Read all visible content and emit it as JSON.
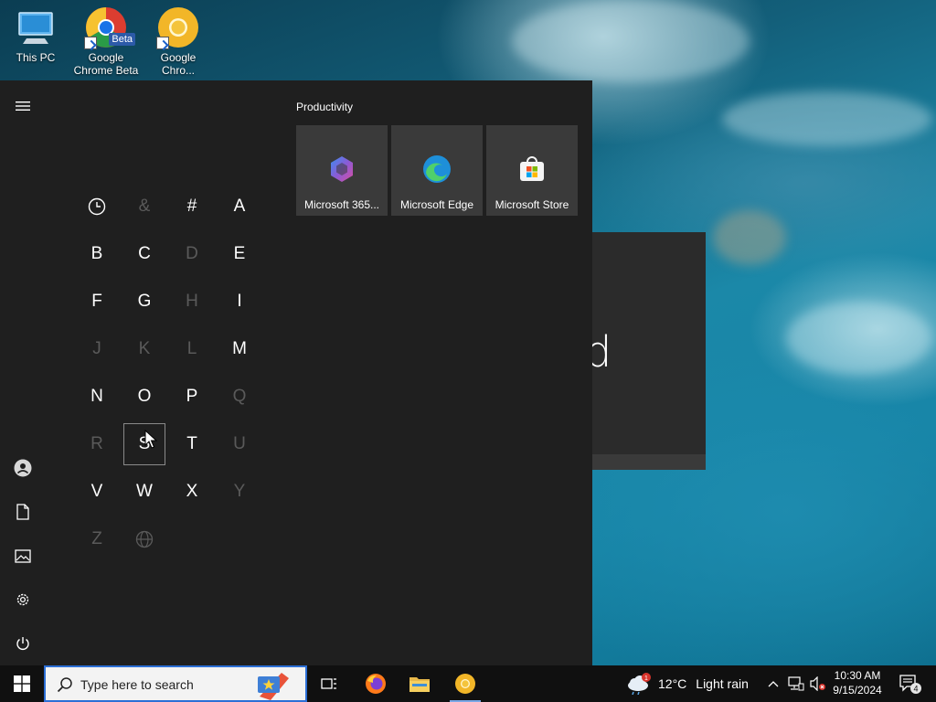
{
  "desktop": {
    "icons": [
      {
        "label": "This PC"
      },
      {
        "label": "Google Chrome Beta",
        "badge": "Beta"
      },
      {
        "label": "Google Chro..."
      }
    ]
  },
  "start_menu": {
    "letters": [
      {
        "char": "clock-icon",
        "enabled": true
      },
      {
        "char": "&",
        "enabled": false
      },
      {
        "char": "#",
        "enabled": true
      },
      {
        "char": "A",
        "enabled": true
      },
      {
        "char": "B",
        "enabled": true
      },
      {
        "char": "C",
        "enabled": true
      },
      {
        "char": "D",
        "enabled": false
      },
      {
        "char": "E",
        "enabled": true
      },
      {
        "char": "F",
        "enabled": true
      },
      {
        "char": "G",
        "enabled": true
      },
      {
        "char": "H",
        "enabled": false
      },
      {
        "char": "I",
        "enabled": true
      },
      {
        "char": "J",
        "enabled": false
      },
      {
        "char": "K",
        "enabled": false
      },
      {
        "char": "L",
        "enabled": false
      },
      {
        "char": "M",
        "enabled": true
      },
      {
        "char": "N",
        "enabled": true
      },
      {
        "char": "O",
        "enabled": true
      },
      {
        "char": "P",
        "enabled": true
      },
      {
        "char": "Q",
        "enabled": false
      },
      {
        "char": "R",
        "enabled": false
      },
      {
        "char": "S",
        "enabled": true
      },
      {
        "char": "T",
        "enabled": true
      },
      {
        "char": "U",
        "enabled": false
      },
      {
        "char": "V",
        "enabled": true
      },
      {
        "char": "W",
        "enabled": true
      },
      {
        "char": "X",
        "enabled": true
      },
      {
        "char": "Y",
        "enabled": false
      },
      {
        "char": "Z",
        "enabled": false
      },
      {
        "char": "globe-icon",
        "enabled": false
      }
    ],
    "tile_group": {
      "title": "Productivity",
      "tiles": [
        {
          "label": "Microsoft 365...",
          "icon": "microsoft-365-icon"
        },
        {
          "label": "Microsoft Edge",
          "icon": "edge-icon"
        },
        {
          "label": "Microsoft Store",
          "icon": "store-icon"
        }
      ]
    },
    "rail": [
      "hamburger-icon",
      "user-icon",
      "document-icon",
      "pictures-icon",
      "settings-icon",
      "power-icon"
    ]
  },
  "background_window": {
    "glyph": "d"
  },
  "taskbar": {
    "search_placeholder": "Type here to search",
    "weather": {
      "temp": "12°C",
      "condition": "Light rain",
      "alert_count": "1"
    },
    "clock": {
      "time": "10:30 AM",
      "date": "9/15/2024"
    },
    "notification_count": "4"
  }
}
